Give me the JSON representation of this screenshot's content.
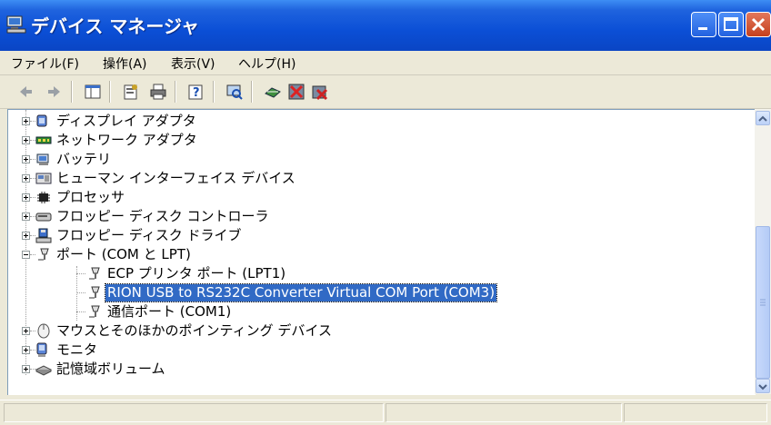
{
  "window": {
    "title": "デバイス マネージャ"
  },
  "menu": [
    {
      "label": "ファイル(F)"
    },
    {
      "label": "操作(A)"
    },
    {
      "label": "表示(V)"
    },
    {
      "label": "ヘルプ(H)"
    }
  ],
  "toolbar": {
    "icons": [
      "back-icon",
      "forward-icon",
      "console-tree-icon",
      "properties-icon",
      "print-icon",
      "help-icon",
      "scan-hardware-icon",
      "update-driver-icon",
      "disable-device-icon",
      "uninstall-device-icon"
    ]
  },
  "tree": {
    "items": [
      {
        "label": "ディスプレイ アダプタ",
        "icon": "display-adapter-icon",
        "expanded": false,
        "level": 0
      },
      {
        "label": "ネットワーク アダプタ",
        "icon": "network-adapter-icon",
        "expanded": false,
        "level": 0
      },
      {
        "label": "バッテリ",
        "icon": "battery-icon",
        "expanded": false,
        "level": 0
      },
      {
        "label": "ヒューマン インターフェイス デバイス",
        "icon": "hid-icon",
        "expanded": false,
        "level": 0
      },
      {
        "label": "プロセッサ",
        "icon": "processor-icon",
        "expanded": false,
        "level": 0
      },
      {
        "label": "フロッピー ディスク コントローラ",
        "icon": "floppy-controller-icon",
        "expanded": false,
        "level": 0
      },
      {
        "label": "フロッピー ディスク ドライブ",
        "icon": "floppy-drive-icon",
        "expanded": false,
        "level": 0
      },
      {
        "label": "ポート (COM と LPT)",
        "icon": "port-icon",
        "expanded": true,
        "level": 0
      },
      {
        "label": "ECP プリンタ ポート (LPT1)",
        "icon": "port-icon",
        "level": 1
      },
      {
        "label": "RION USB to RS232C Converter Virtual COM Port (COM3)",
        "icon": "port-icon",
        "level": 1,
        "selected": true
      },
      {
        "label": "通信ポート (COM1)",
        "icon": "port-icon",
        "level": 1
      },
      {
        "label": "マウスとそのほかのポインティング デバイス",
        "icon": "mouse-icon",
        "expanded": false,
        "level": 0
      },
      {
        "label": "モニタ",
        "icon": "monitor-icon",
        "expanded": false,
        "level": 0
      },
      {
        "label": "記憶域ボリューム",
        "icon": "storage-volume-icon",
        "expanded": false,
        "level": 0
      }
    ]
  },
  "colors": {
    "titlebar": "#0b4fd6",
    "selection": "#316ac5",
    "chrome": "#ece9d8"
  }
}
